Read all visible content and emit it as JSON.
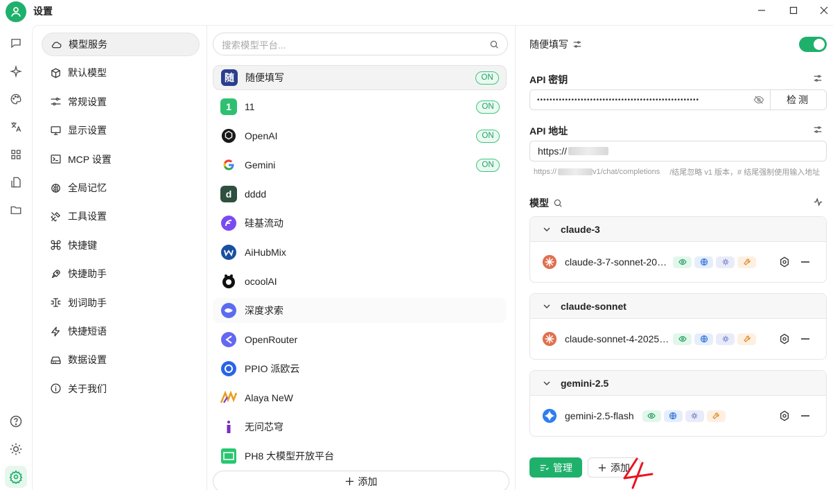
{
  "window": {
    "title": "设置"
  },
  "rail": {
    "icons": [
      "chat-icon",
      "sparkle-icon",
      "palette-icon",
      "translate-icon",
      "apps-icon",
      "file-transfer-icon",
      "folder-icon",
      "help-icon",
      "brightness-icon",
      "settings-icon"
    ]
  },
  "nav": {
    "items": [
      {
        "label": "模型服务",
        "icon": "cloud-icon"
      },
      {
        "label": "默认模型",
        "icon": "cube-icon"
      },
      {
        "label": "常规设置",
        "icon": "sliders-icon"
      },
      {
        "label": "显示设置",
        "icon": "monitor-icon"
      },
      {
        "label": "MCP 设置",
        "icon": "terminal-icon"
      },
      {
        "label": "全局记忆",
        "icon": "brain-icon"
      },
      {
        "label": "工具设置",
        "icon": "tools-icon"
      },
      {
        "label": "快捷键",
        "icon": "command-icon"
      },
      {
        "label": "快捷助手",
        "icon": "rocket-icon"
      },
      {
        "label": "划词助手",
        "icon": "text-cursor-icon"
      },
      {
        "label": "快捷短语",
        "icon": "zap-icon"
      },
      {
        "label": "数据设置",
        "icon": "hard-drive-icon"
      },
      {
        "label": "关于我们",
        "icon": "info-icon"
      }
    ]
  },
  "providers": {
    "search_placeholder": "搜索模型平台...",
    "on_label": "ON",
    "add_label": "添加",
    "items": [
      {
        "name": "随便填写",
        "logo_text": "随",
        "color": "#2b3f8f",
        "on": true
      },
      {
        "name": "11",
        "logo_text": "1",
        "color": "#2fbf71",
        "on": true
      },
      {
        "name": "OpenAI",
        "logo_text": "",
        "color": "#1a1a1a",
        "on": true
      },
      {
        "name": "Gemini",
        "logo_text": "G",
        "color": "#ffffff",
        "on": true
      },
      {
        "name": "dddd",
        "logo_text": "d",
        "color": "#2f4f3f",
        "on": false
      },
      {
        "name": "硅基流动",
        "logo_text": "",
        "color": "#7a4cf0",
        "on": false
      },
      {
        "name": "AiHubMix",
        "logo_text": "",
        "color": "#1a4fa0",
        "on": false
      },
      {
        "name": "ocoolAI",
        "logo_text": "",
        "color": "#111111",
        "on": false
      },
      {
        "name": "深度求索",
        "logo_text": "",
        "color": "#5b6cf0",
        "on": false
      },
      {
        "name": "OpenRouter",
        "logo_text": "",
        "color": "#6566f1",
        "on": false
      },
      {
        "name": "PPIO 派欧云",
        "logo_text": "",
        "color": "#2a63e8",
        "on": false
      },
      {
        "name": "Alaya NeW",
        "logo_text": "",
        "color": "#e8a020",
        "on": false
      },
      {
        "name": "无问芯穹",
        "logo_text": "I",
        "color": "#ffffff",
        "on": false
      },
      {
        "name": "PH8 大模型开放平台",
        "logo_text": "",
        "color": "#28c76f",
        "on": false
      }
    ]
  },
  "detail": {
    "provider_name": "随便填写",
    "api_key_label": "API 密钥",
    "api_key_value": "••••••••••••••••••••••••••••••••••••••••••••••••••••",
    "check_label": "检测",
    "api_url_label": "API 地址",
    "api_url_prefix": "https://",
    "url_hint_prefix": "https://",
    "url_hint_suffix": "v1/chat/completions",
    "url_hint_note": "/结尾忽略 v1 版本，# 结尾强制使用输入地址",
    "models_label": "模型",
    "groups": [
      {
        "name": "claude-3",
        "model": "claude-3-7-sonnet-20…",
        "logo_color": "#e0704f"
      },
      {
        "name": "claude-sonnet",
        "model": "claude-sonnet-4-2025…",
        "logo_color": "#e0704f"
      },
      {
        "name": "gemini-2.5",
        "model": "gemini-2.5-flash",
        "logo_color": "#2d7ff0"
      }
    ],
    "manage_label": "管理",
    "add_label": "添加"
  },
  "colors": {
    "accent": "#1fb16b",
    "on_badge": "#3cc47e"
  }
}
